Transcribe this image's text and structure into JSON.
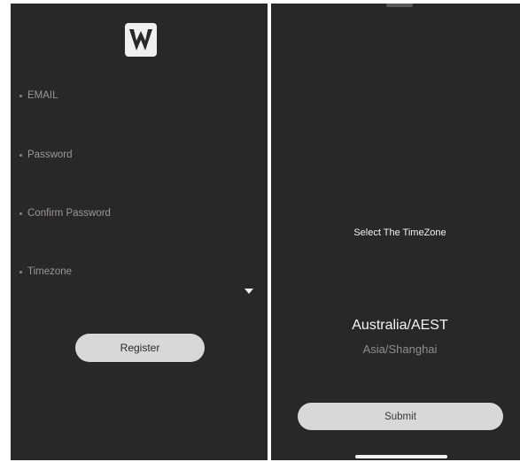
{
  "register_screen": {
    "logo_icon": "vw-logo-icon",
    "fields": {
      "email_label": "EMAIL",
      "password_label": "Password",
      "confirm_password_label": "Confirm Password",
      "timezone_label": "Timezone"
    },
    "dropdown_icon": "caret-down-icon",
    "register_label": "Register"
  },
  "timezone_screen": {
    "title": "Select The TimeZone",
    "options": [
      "Australia/AEST",
      "Asia/Shanghai"
    ],
    "selected": "Australia/AEST",
    "submit_label": "Submit"
  },
  "colors": {
    "background": "#2a2727",
    "button": "#d9d8d8",
    "text_light": "#f2f2f2",
    "text_muted": "#9a9898"
  }
}
